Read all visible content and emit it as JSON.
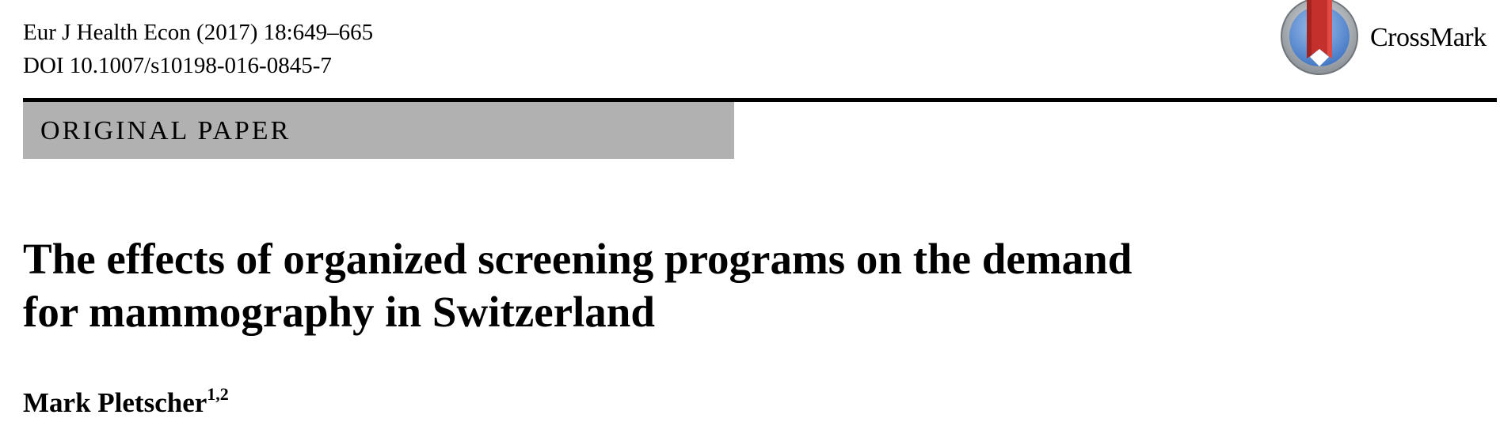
{
  "journal": {
    "citation": "Eur J Health Econ (2017) 18:649–665",
    "doi": "DOI 10.1007/s10198-016-0845-7"
  },
  "crossmark": {
    "label": "CrossMark",
    "icon": "crossmark-icon",
    "colors": {
      "ring": "#9aa0a6",
      "inner": "#5b8fd6",
      "ribbon": "#c4302b"
    }
  },
  "article_type": {
    "label": "ORIGINAL PAPER",
    "band_color": "#b1b1b1"
  },
  "title": {
    "line1": "The effects of organized screening programs on the demand",
    "line2": "for mammography in Switzerland"
  },
  "author": {
    "name": "Mark Pletscher",
    "affiliations": "1,2"
  }
}
